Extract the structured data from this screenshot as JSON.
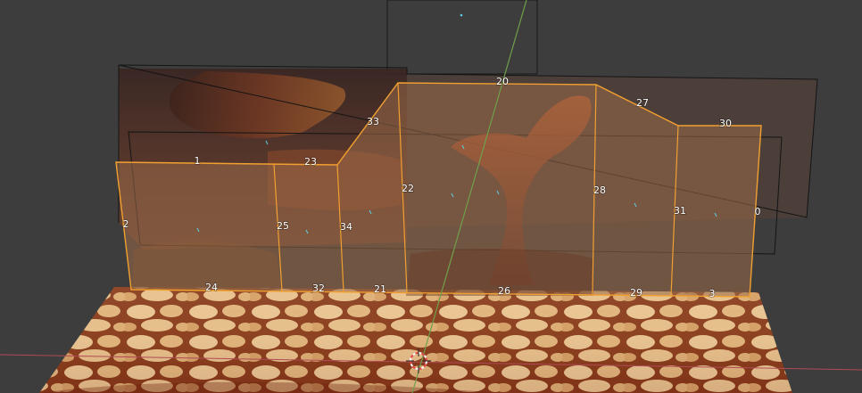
{
  "viewport": {
    "mode": "3D viewport",
    "colors": {
      "background": "#3d3d3d",
      "selection_outline": "#f0a030",
      "wireframe": "#141414",
      "axis_y": "#6fa04a",
      "axis_x": "#b04a55",
      "normals": "#5ad2e6"
    }
  },
  "edge_labels": [
    "0",
    "1",
    "2",
    "3",
    "20",
    "21",
    "22",
    "23",
    "24",
    "25",
    "26",
    "27",
    "28",
    "29",
    "30",
    "31",
    "32",
    "33",
    "34"
  ],
  "objects": {
    "ground_plane": "rocky ground texture",
    "background_planes": "sky and tree texture",
    "selected_mesh": "bonsai tree cliff mesh",
    "cursor": "3d-cursor-icon"
  }
}
